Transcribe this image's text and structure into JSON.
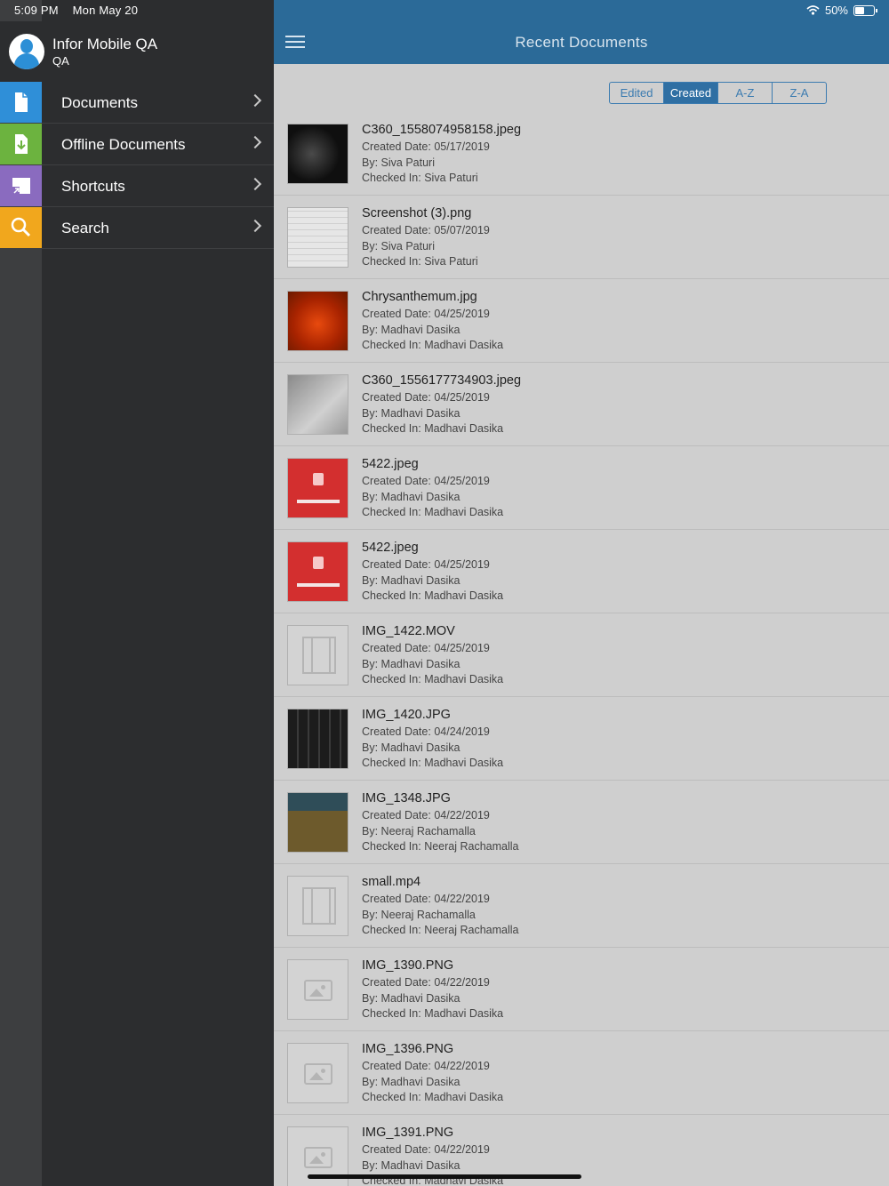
{
  "status": {
    "time": "5:09 PM",
    "date": "Mon May 20",
    "battery": "50%"
  },
  "profile": {
    "name": "Infor Mobile QA",
    "role": "QA"
  },
  "menu": [
    {
      "label": "Documents",
      "icon": "document-icon",
      "color": "#2f8fd8"
    },
    {
      "label": "Offline Documents",
      "icon": "download-document-icon",
      "color": "#6cb33f"
    },
    {
      "label": "Shortcuts",
      "icon": "shortcut-icon",
      "color": "#8a6bbf"
    },
    {
      "label": "Search",
      "icon": "search-icon",
      "color": "#f1a71d"
    }
  ],
  "header": {
    "title": "Recent Documents"
  },
  "sort": {
    "options": [
      "Edited",
      "Created",
      "A-Z",
      "Z-A"
    ],
    "active": "Created"
  },
  "labels": {
    "created": "Created Date:",
    "by": "By:",
    "checked": "Checked In:"
  },
  "documents": [
    {
      "name": "C360_1558074958158.jpeg",
      "created": "05/17/2019",
      "by": "Siva Paturi",
      "checked": "Siva Paturi",
      "thumb": "dark"
    },
    {
      "name": "Screenshot (3).png",
      "created": "05/07/2019",
      "by": "Siva Paturi",
      "checked": "Siva Paturi",
      "thumb": "screen"
    },
    {
      "name": "Chrysanthemum.jpg",
      "created": "04/25/2019",
      "by": "Madhavi Dasika",
      "checked": "Madhavi Dasika",
      "thumb": "flower"
    },
    {
      "name": "C360_1556177734903.jpeg",
      "created": "04/25/2019",
      "by": "Madhavi Dasika",
      "checked": "Madhavi Dasika",
      "thumb": "gray"
    },
    {
      "name": "5422.jpeg",
      "created": "04/25/2019",
      "by": "Madhavi Dasika",
      "checked": "Madhavi Dasika",
      "thumb": "red"
    },
    {
      "name": "5422.jpeg",
      "created": "04/25/2019",
      "by": "Madhavi Dasika",
      "checked": "Madhavi Dasika",
      "thumb": "red"
    },
    {
      "name": "IMG_1422.MOV",
      "created": "04/25/2019",
      "by": "Madhavi Dasika",
      "checked": "Madhavi Dasika",
      "thumb": "video"
    },
    {
      "name": "IMG_1420.JPG",
      "created": "04/24/2019",
      "by": "Madhavi Dasika",
      "checked": "Madhavi Dasika",
      "thumb": "keys"
    },
    {
      "name": "IMG_1348.JPG",
      "created": "04/22/2019",
      "by": "Neeraj Rachamalla",
      "checked": "Neeraj Rachamalla",
      "thumb": "desk"
    },
    {
      "name": "small.mp4",
      "created": "04/22/2019",
      "by": "Neeraj Rachamalla",
      "checked": "Neeraj Rachamalla",
      "thumb": "video"
    },
    {
      "name": "IMG_1390.PNG",
      "created": "04/22/2019",
      "by": "Madhavi Dasika",
      "checked": "Madhavi Dasika",
      "thumb": "image"
    },
    {
      "name": "IMG_1396.PNG",
      "created": "04/22/2019",
      "by": "Madhavi Dasika",
      "checked": "Madhavi Dasika",
      "thumb": "image"
    },
    {
      "name": "IMG_1391.PNG",
      "created": "04/22/2019",
      "by": "Madhavi Dasika",
      "checked": "Madhavi Dasika",
      "thumb": "image"
    }
  ]
}
